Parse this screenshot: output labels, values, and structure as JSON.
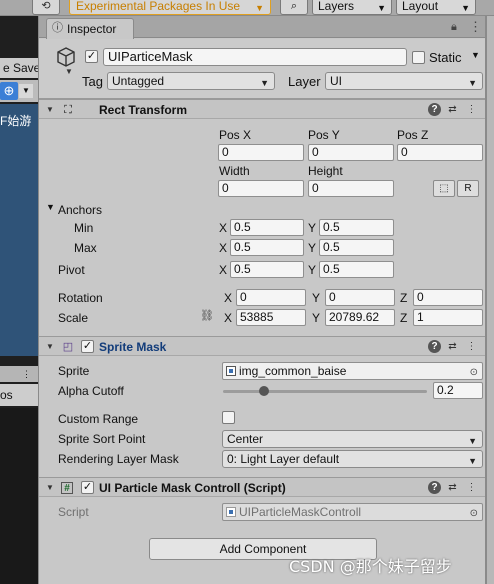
{
  "toolbar": {
    "history_icon": "history-icon",
    "packages_label": "Experimental Packages In Use",
    "search_icon": "search-icon",
    "layers_label": "Layers",
    "layout_label": "Layout"
  },
  "left_panel": {
    "save_label": "e Save",
    "scene_text": "F始游",
    "pos_label": "os"
  },
  "inspector": {
    "tab_label": "Inspector",
    "game_object": {
      "active": true,
      "name": "UIParticeMask",
      "static_label": "Static",
      "static_checked": false,
      "tag_label": "Tag",
      "tag_value": "Untagged",
      "layer_label": "Layer",
      "layer_value": "UI"
    },
    "rect_transform": {
      "title": "Rect Transform",
      "pos_x_label": "Pos X",
      "pos_y_label": "Pos Y",
      "pos_z_label": "Pos Z",
      "pos_x": "0",
      "pos_y": "0",
      "pos_z": "0",
      "width_label": "Width",
      "height_label": "Height",
      "width": "0",
      "height": "0",
      "raw_edit_label": "R",
      "anchors_label": "Anchors",
      "min_label": "Min",
      "max_label": "Max",
      "pivot_label": "Pivot",
      "axis_x": "X",
      "axis_y": "Y",
      "axis_z": "Z",
      "min_x": "0.5",
      "min_y": "0.5",
      "max_x": "0.5",
      "max_y": "0.5",
      "pivot_x": "0.5",
      "pivot_y": "0.5",
      "rotation_label": "Rotation",
      "rotation_x": "0",
      "rotation_y": "0",
      "rotation_z": "0",
      "scale_label": "Scale",
      "scale_x": "53885",
      "scale_y": "20789.62",
      "scale_z": "1"
    },
    "sprite_mask": {
      "title": "Sprite Mask",
      "enabled": true,
      "sprite_label": "Sprite",
      "sprite_value": "img_common_baise",
      "alpha_cutoff_label": "Alpha Cutoff",
      "alpha_cutoff_value": "0.2",
      "alpha_cutoff_fraction": 0.2,
      "custom_range_label": "Custom Range",
      "custom_range_checked": false,
      "sort_point_label": "Sprite Sort Point",
      "sort_point_value": "Center",
      "rendering_layer_label": "Rendering Layer Mask",
      "rendering_layer_value": "0: Light Layer default"
    },
    "script_component": {
      "title": "UI Particle Mask Controll (Script)",
      "enabled": true,
      "script_label": "Script",
      "script_value": "UIParticleMaskControll"
    },
    "add_component_label": "Add Component"
  },
  "watermark": "CSDN @那个妹子留步",
  "colors": {
    "accent": "#3b7fd6",
    "warning": "#c77f00",
    "panel": "#c8c8c8"
  }
}
